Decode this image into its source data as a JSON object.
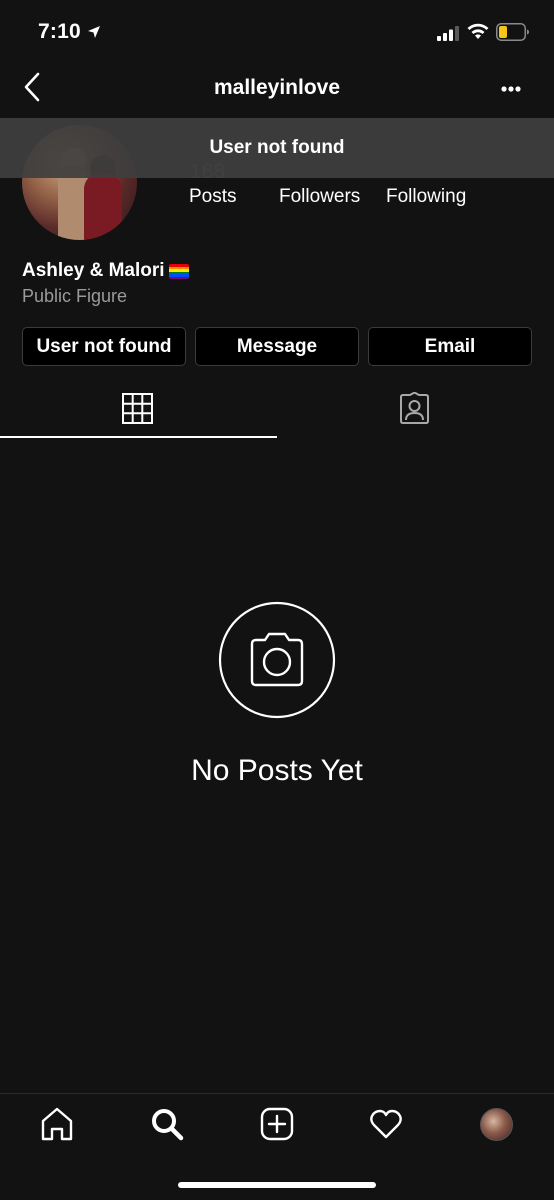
{
  "status_bar": {
    "time": "7:10",
    "icons": [
      "location-arrow-icon",
      "cellular-signal-icon",
      "wifi-icon",
      "battery-icon"
    ]
  },
  "header": {
    "username": "malleyinlove",
    "back_icon": "chevron-left-icon",
    "more_icon": "ellipsis-icon"
  },
  "toast": {
    "message": "User not found"
  },
  "profile": {
    "post_count": "168",
    "stats": {
      "posts_label": "Posts",
      "followers_label": "Followers",
      "following_label": "Following"
    },
    "name": "Ashley & Malori",
    "flag_icon": "rainbow-flag-icon",
    "category": "Public Figure"
  },
  "actions": {
    "follow_label": "User not found",
    "message_label": "Message",
    "email_label": "Email"
  },
  "tabs": {
    "grid_icon": "grid-icon",
    "tagged_icon": "tagged-person-icon",
    "active": "grid"
  },
  "empty_state": {
    "icon": "camera-icon",
    "text": "No Posts Yet"
  },
  "bottom_nav": {
    "items": [
      "home-icon",
      "search-icon",
      "add-post-icon",
      "heart-icon",
      "profile-avatar"
    ],
    "active": "search"
  },
  "colors": {
    "background": "#121212",
    "button_bg": "#000000",
    "button_border": "#3b3b3b",
    "muted_text": "#9a9a9a",
    "toast_bg": "#3e3e3e",
    "battery_level": "#f5c518"
  }
}
